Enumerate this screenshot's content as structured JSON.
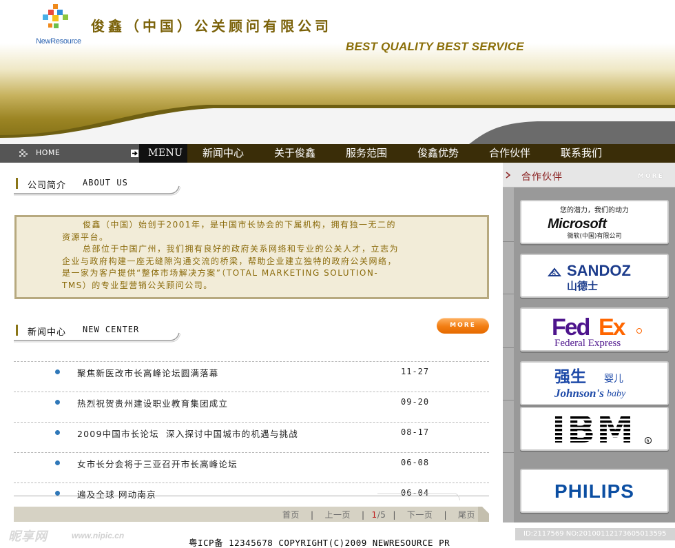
{
  "header": {
    "logo_text": "NewResource",
    "company_name": "俊鑫（中国）公关顾问有限公司",
    "slogan": "BEST QUALITY BEST SERVICE"
  },
  "nav": {
    "home": "HOME",
    "menu": "MENU",
    "items": [
      "新闻中心",
      "关于俊鑫",
      "服务范围",
      "俊鑫优势",
      "合作伙伴",
      "联系我们"
    ]
  },
  "about": {
    "title_cn": "公司简介",
    "title_en": "ABOUT US",
    "paragraph1": "俊鑫（中国）始创于2001年，是中国市长协会的下属机构，拥有独一无二的资源平台。",
    "paragraph2": "总部位于中国广州，我们拥有良好的政府关系网络和专业的公关人才，立志为企业与政府构建一座无缝隙沟通交流的桥梁，帮助企业建立独特的政府公关网络，是一家为客户提供“整体市场解决方案”（TOTAL MARKETING SOLUTION-TMS）的专业型营销公关顾问公司。"
  },
  "news": {
    "title_cn": "新闻中心",
    "title_en": "NEW CENTER",
    "more": "MORE",
    "items": [
      {
        "title": "聚焦新医改市长高峰论坛圆满落幕",
        "date": "11-27"
      },
      {
        "title": "热烈祝贺贵州建设职业教育集团成立",
        "date": "09-20"
      },
      {
        "title": "2009中国市长论坛  深入探讨中国城市的机遇与挑战",
        "date": "08-17"
      },
      {
        "title": "女市长分会将于三亚召开市长高峰论坛",
        "date": "06-08"
      },
      {
        "title": "遍及全球 网动南京",
        "date": "06-04"
      }
    ]
  },
  "pager": {
    "first": "首页",
    "prev": "上一页",
    "current": "1",
    "total": "/5",
    "next": "下一页",
    "last": "尾页"
  },
  "footer": {
    "copyright": "粤ICP备 12345678 COPYRIGHT(C)2009 NEWRESOURCE PR"
  },
  "watermark": {
    "brand": "昵享网",
    "url": "www.nipic.cn",
    "id": "ID:2117569 NO:20100112173605013595"
  },
  "sidebar": {
    "title": "合作伙伴",
    "more": "MORE",
    "partners": {
      "microsoft": {
        "tagline": "您的潜力，我们的动力",
        "name": "Microsoft",
        "sub": "微软(中国)有限公司"
      },
      "sandoz": {
        "name": "SANDOZ",
        "cn": "山德士"
      },
      "fedex": {
        "fed": "Fed",
        "ex": "Ex",
        "sub": "Federal Express"
      },
      "johnson": {
        "cn1": "强生",
        "cn2": "婴儿",
        "name": "Johnson's",
        "baby": "baby"
      },
      "ibm": {
        "name": "IBM"
      },
      "philips": {
        "name": "PHILIPS"
      }
    }
  },
  "colors": {
    "gold": "#7a6108",
    "nav_bg": "#3a2d08",
    "accent_orange": "#f27d12",
    "side_bg": "#999999"
  }
}
